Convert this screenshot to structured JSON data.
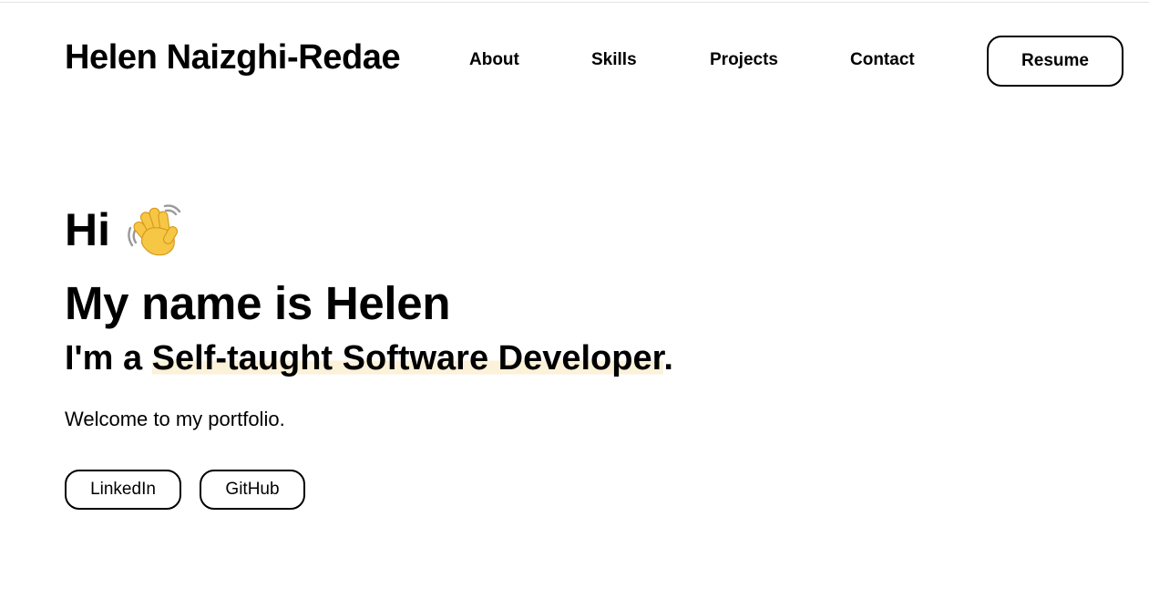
{
  "header": {
    "brand": "Helen Naizghi-Redae",
    "nav": [
      {
        "label": "About"
      },
      {
        "label": "Skills"
      },
      {
        "label": "Projects"
      },
      {
        "label": "Contact"
      }
    ],
    "resume_label": "Resume"
  },
  "hero": {
    "greeting": "Hi",
    "greeting_icon": "waving-hand-icon",
    "intro": "My name is Helen",
    "role_prefix": "I'm a ",
    "role_highlight": "Self-taught Software Developer",
    "role_suffix": ".",
    "welcome": "Welcome to my portfolio.",
    "links": [
      {
        "label": "LinkedIn"
      },
      {
        "label": "GitHub"
      }
    ]
  },
  "colors": {
    "text": "#000000",
    "background": "#ffffff",
    "highlight": "#fcf1d9",
    "wave_skin": "#f6c744"
  }
}
